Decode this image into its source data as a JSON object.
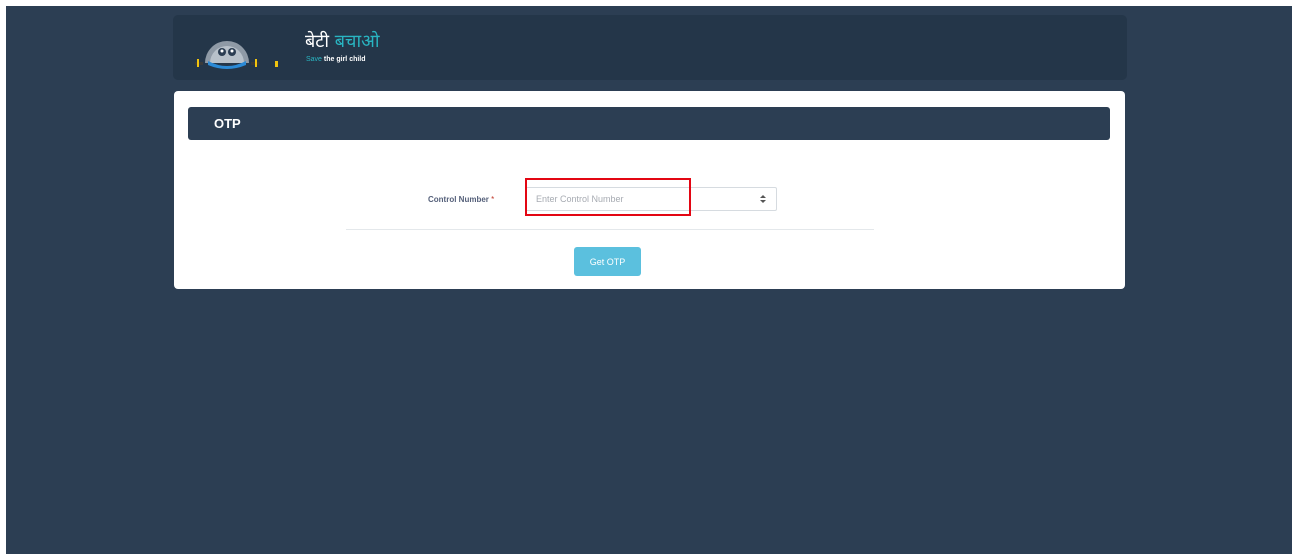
{
  "brand": {
    "title_hi_part1": "बेटी",
    "title_hi_part2": "बचाओ",
    "tagline_prefix": "Save",
    "tagline_rest": " the girl child",
    "accent_color": "#29b5c2"
  },
  "card": {
    "title": "OTP"
  },
  "form": {
    "control_number_label": "Control Number",
    "required_marker": "*",
    "control_number_placeholder": "Enter Control Number",
    "control_number_value": "",
    "submit_label": "Get OTP"
  },
  "icons": {
    "logo": "logo-icon",
    "stepper": "stepper-icon"
  },
  "colors": {
    "background": "#2c3e53",
    "header_bar": "#243649",
    "button": "#5bc0de",
    "highlight": "#e30613"
  }
}
